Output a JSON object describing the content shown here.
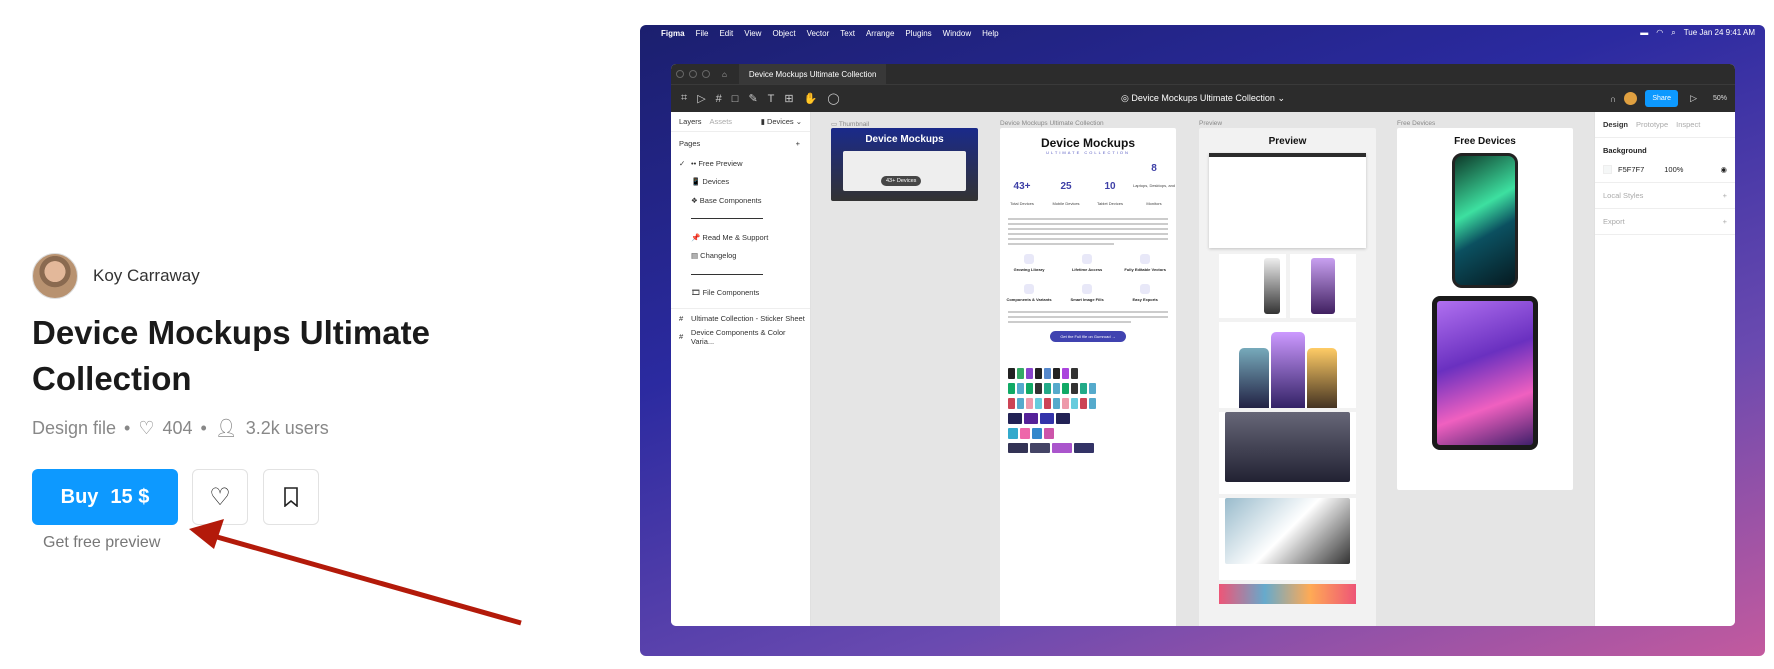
{
  "product": {
    "author": "Koy Carraway",
    "title": "Device Mockups Ultimate Collection",
    "type": "Design file",
    "likes": "404",
    "users": "3.2k users",
    "buy_label": "Buy",
    "price": "15 $",
    "preview_link": "Get free preview"
  },
  "figma": {
    "menubar": {
      "app": "Figma",
      "items": [
        "File",
        "Edit",
        "View",
        "Object",
        "Vector",
        "Text",
        "Arrange",
        "Plugins",
        "Window",
        "Help"
      ],
      "datetime": "Tue Jan 24  9:41 AM"
    },
    "tab_title": "Device Mockups Ultimate Collection",
    "file_name": "Device Mockups Ultimate Collection",
    "share_label": "Share",
    "zoom": "50%",
    "layers": {
      "tabs": [
        "Layers",
        "Assets"
      ],
      "page_select": "Devices",
      "pages_label": "Pages",
      "pages": [
        "•• Free Preview",
        "📱 Devices",
        "❖ Base Components",
        "📌 Read Me & Support",
        "▤ Changelog",
        "🎞 File Components"
      ],
      "frames": [
        "Ultimate Collection - Sticker Sheet",
        "Device Components & Color Varia..."
      ]
    },
    "props": {
      "tabs": [
        "Design",
        "Prototype",
        "Inspect"
      ],
      "background_label": "Background",
      "bg_hex": "F5F7F7",
      "bg_opacity": "100%",
      "local_styles": "Local Styles",
      "export": "Export"
    },
    "canvas": {
      "labels": [
        "Thumbnail",
        "Device Mockups Ultimate Collection",
        "Preview",
        "Free Devices"
      ],
      "thumb_title": "Device Mockups",
      "thumb_badge": "43+ Devices",
      "doc_title": "Device Mockups",
      "doc_subtitle": "ULTIMATE COLLECTION",
      "stats": [
        {
          "n": "43+",
          "l": "Total Devices"
        },
        {
          "n": "25",
          "l": "Mobile Devices"
        },
        {
          "n": "10",
          "l": "Tablet Devices"
        },
        {
          "n": "8",
          "l": "Laptops, Desktops, and Monitors"
        }
      ],
      "features": [
        "Growing Library",
        "Lifetime Access",
        "Fully Editable Vectors",
        "Components & Variants",
        "Smart Image Fills",
        "Easy Exports"
      ],
      "cta": "Get the Full file on Gumroad →",
      "preview_title": "Preview",
      "free_title": "Free Devices"
    }
  },
  "colors": {
    "accent": "#0d99ff",
    "arrow": "#b31a0a"
  }
}
